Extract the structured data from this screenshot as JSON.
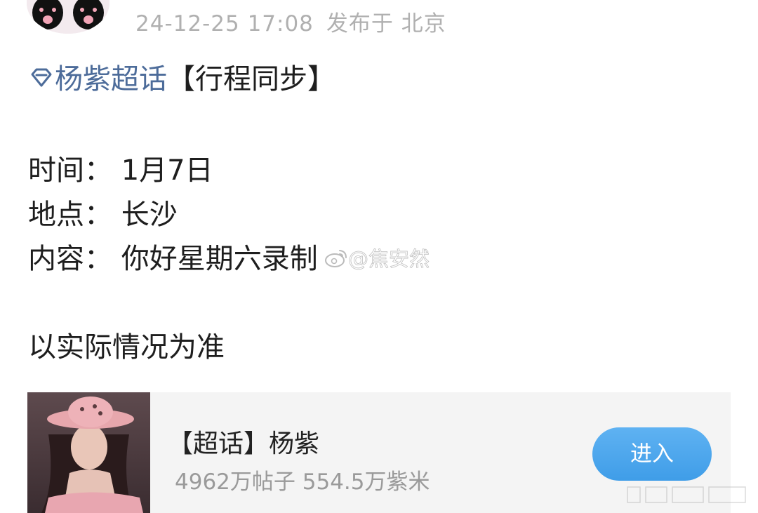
{
  "post": {
    "date": "24-12-25 17:08",
    "location": "发布于 北京",
    "topic": "杨紫超话",
    "tag": "【行程同步】",
    "lines": {
      "time": "时间： 1月7日",
      "place": "地点： 长沙",
      "content": "内容： 你好星期六录制",
      "note": "以实际情况为准"
    },
    "watermark": "@焦安然"
  },
  "card": {
    "title": "【超话】杨紫",
    "stats": "4962万帖子 554.5万紫米",
    "enter_label": "进入"
  },
  "colors": {
    "link": "#4d6c9a",
    "button": "#3f9de8",
    "meta": "#b0b0b0"
  },
  "icons": {
    "topic": "diamond-icon",
    "watermark": "weibo-logo-icon"
  }
}
